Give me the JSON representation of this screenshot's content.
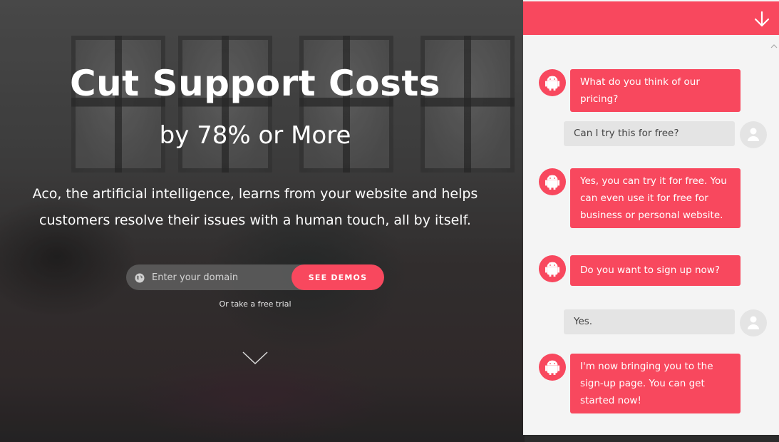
{
  "hero": {
    "title": "Cut Support Costs",
    "subtitle": "by 78% or More",
    "description": "Aco, the artificial intelligence, learns from your website and helps customers resolve their issues with a human touch, all by itself.",
    "domain_placeholder": "Enter your domain",
    "cta_label": "SEE DEMOS",
    "trial_link": "Or take a free trial"
  },
  "chat": {
    "messages": [
      {
        "from": "bot",
        "text": "What do you think of our pricing?"
      },
      {
        "from": "user",
        "text": "Can I try this for free?"
      },
      {
        "from": "bot",
        "text": "Yes, you can try it for free. You can even use it for free for business or personal website."
      },
      {
        "from": "bot",
        "text": "Do you want to sign up now?"
      },
      {
        "from": "user",
        "text": "Yes."
      },
      {
        "from": "bot",
        "text": "I'm now bringing you to the sign-up page. You can get started now!"
      }
    ]
  },
  "colors": {
    "accent": "#f8485e",
    "user_bubble": "#e4e4e4",
    "chat_bg": "#f4f4f4"
  },
  "icons": [
    "globe-icon",
    "scroll-down-chevron-icon",
    "collapse-arrow-icon",
    "android-bot-icon",
    "user-silhouette-icon"
  ]
}
